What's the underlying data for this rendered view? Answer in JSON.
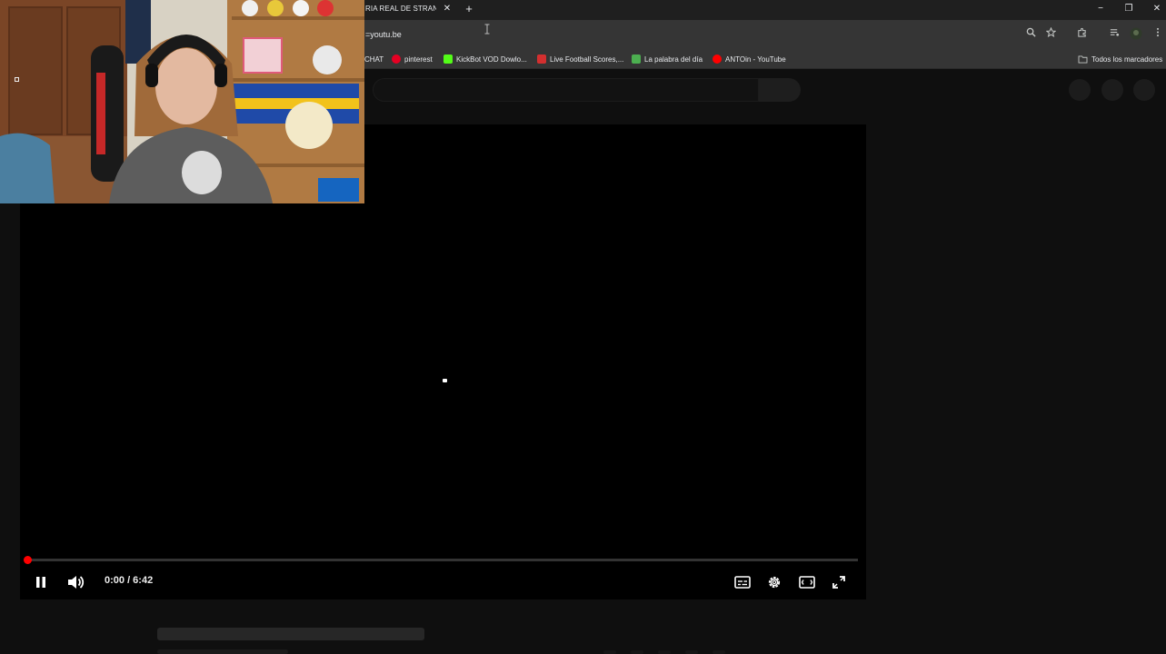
{
  "browser": {
    "active_tab_title": "RIA REAL DE STRANGE",
    "tab_close_glyph": "✕",
    "new_tab_glyph": "+",
    "url": "=youtu.be",
    "window_controls": {
      "minimize": "−",
      "restore": "❐",
      "close": "✕"
    },
    "toolbar_icons": [
      "zoom-icon",
      "bookmark-star-icon",
      "extensions-icon",
      "media-controls-icon",
      "profile-avatar-icon",
      "menu-icon"
    ]
  },
  "bookmarks": {
    "items": [
      {
        "label": "CHAT",
        "icon_color": ""
      },
      {
        "label": "pinterest",
        "icon_color": "#e60023"
      },
      {
        "label": "KickBot VOD Dowlo...",
        "icon_color": "#53fc18"
      },
      {
        "label": "Live Football Scores,...",
        "icon_color": "#d32f2f"
      },
      {
        "label": "La palabra del día",
        "icon_color": "#4caf50"
      },
      {
        "label": "ANTOin - YouTube",
        "icon_color": "#ff0000"
      }
    ],
    "all_bookmarks_label": "Todos los marcadores"
  },
  "player": {
    "time": "0:00 / 6:42",
    "progress": 0.0,
    "state": "loading",
    "accent": "#ff0000"
  }
}
